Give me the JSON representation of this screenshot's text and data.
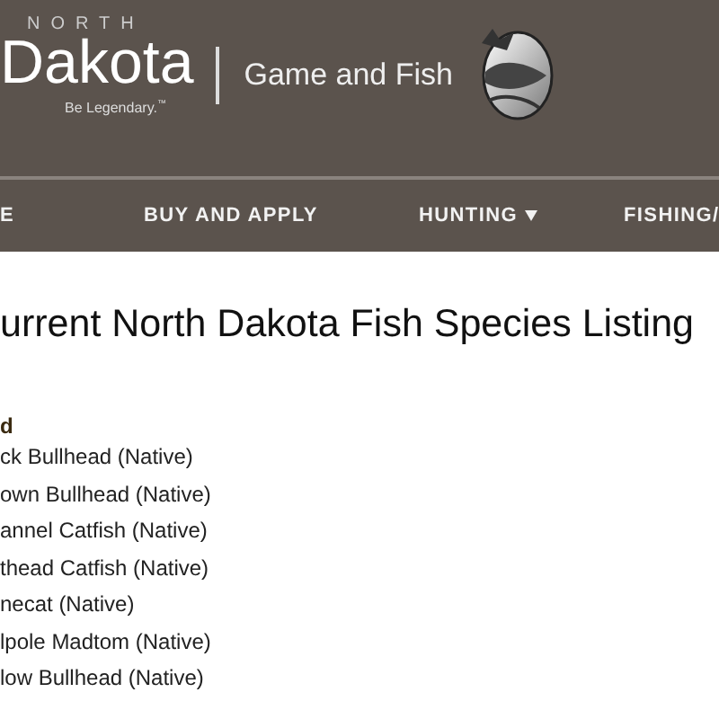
{
  "header": {
    "logo_top": "NORTH",
    "logo_main": "Dakota",
    "tagline": "Be Legendary.",
    "tm": "™",
    "agency": "Game and Fish"
  },
  "nav": [
    {
      "label": "E",
      "dropdown": false
    },
    {
      "label": "BUY AND APPLY",
      "dropdown": false
    },
    {
      "label": "HUNTING",
      "dropdown": true
    },
    {
      "label": "FISHING/"
    }
  ],
  "page_title": "urrent North Dakota Fish Species Listing",
  "group_heading": "d",
  "species": [
    "ck Bullhead (Native)",
    "own Bullhead (Native)",
    "annel Catfish (Native)",
    "thead Catfish (Native)",
    "necat (Native)",
    "lpole Madtom (Native)",
    "low Bullhead (Native)"
  ]
}
